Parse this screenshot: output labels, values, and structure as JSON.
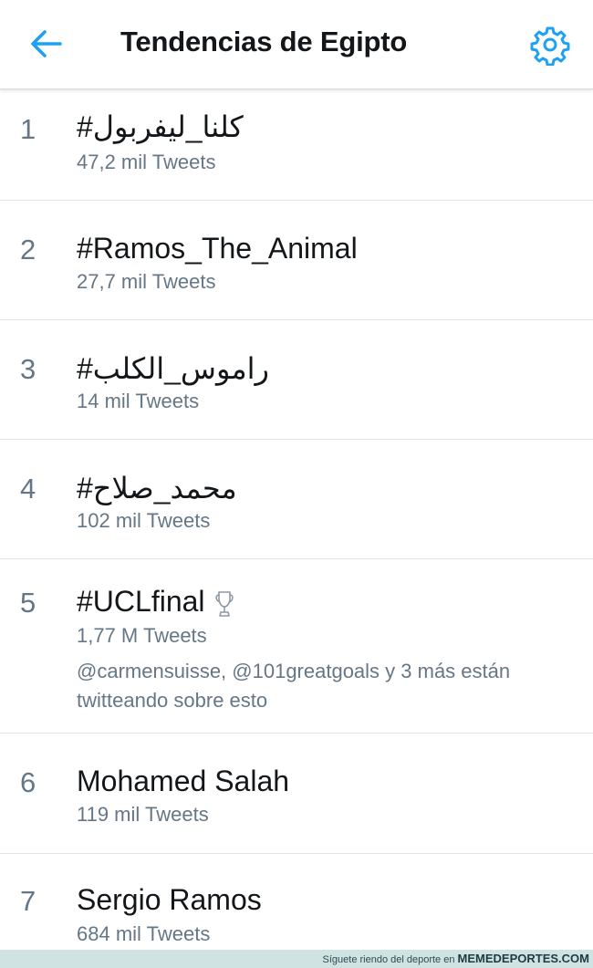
{
  "header": {
    "title": "Tendencias de Egipto"
  },
  "trends": [
    {
      "rank": "1",
      "name": "#كلنا_ليفربول",
      "count": "47,2 mil Tweets"
    },
    {
      "rank": "2",
      "name": "#Ramos_The_Animal",
      "count": "27,7 mil Tweets"
    },
    {
      "rank": "3",
      "name": "#راموس_الكلب",
      "count": "14 mil Tweets"
    },
    {
      "rank": "4",
      "name": "#محمد_صلاح",
      "count": "102 mil Tweets"
    },
    {
      "rank": "5",
      "name": "#UCLfinal",
      "count": "1,77 M Tweets",
      "context_line1": "@carmensuisse, @101greatgoals y 3 más están",
      "context_line2": "twitteando sobre esto"
    },
    {
      "rank": "6",
      "name": "Mohamed Salah",
      "count": "119 mil Tweets"
    },
    {
      "rank": "7",
      "name": "Sergio Ramos",
      "count": "684 mil Tweets"
    }
  ],
  "footer": {
    "text": "Síguete riendo del deporte en",
    "brand": "MEMEDEPORTES.COM"
  },
  "colors": {
    "accent": "#1da1f2",
    "text_primary": "#14171a",
    "text_secondary": "#657786",
    "footer_bg": "#cfe3e3"
  },
  "icons": [
    "back-arrow-icon",
    "gear-icon",
    "trophy-icon"
  ]
}
